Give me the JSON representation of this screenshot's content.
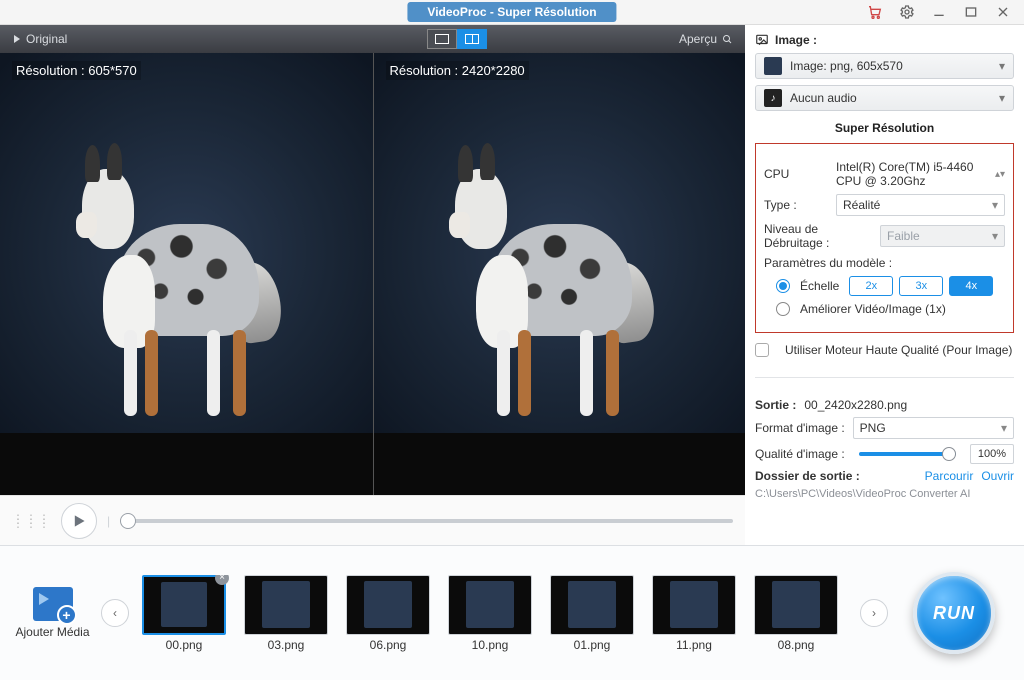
{
  "titlebar": {
    "title": "VideoProc  -  Super Résolution"
  },
  "preview": {
    "original_label": "Original",
    "apercu_label": "Aperçu",
    "left_res": "Résolution : 605*570",
    "right_res": "Résolution : 2420*2280"
  },
  "side": {
    "image_section": "Image :",
    "image_row": "Image: png, 605x570",
    "audio_row": "Aucun audio",
    "sr_title": "Super Résolution",
    "cpu_label": "CPU",
    "cpu_value": "Intel(R) Core(TM) i5-4460 CPU @ 3.20Ghz",
    "type_label": "Type :",
    "type_value": "Réalité",
    "denoise_label": "Niveau de Débruitage :",
    "denoise_value": "Faible",
    "model_label": "Paramètres du modèle :",
    "scale_label": "Échelle",
    "scale_2x": "2x",
    "scale_3x": "3x",
    "scale_4x": "4x",
    "enhance_label": "Améliorer Vidéo/Image (1x)",
    "hq_engine": "Utiliser Moteur Haute Qualité (Pour Image)",
    "output": {
      "sortie_label": "Sortie :",
      "sortie_value": "00_2420x2280.png",
      "format_label": "Format d'image :",
      "format_value": "PNG",
      "quality_label": "Qualité d'image :",
      "quality_value": "100%",
      "folder_label": "Dossier de sortie :",
      "browse": "Parcourir",
      "open": "Ouvrir",
      "path": "C:\\Users\\PC\\Videos\\VideoProc Converter AI"
    }
  },
  "bottom": {
    "add_media": "Ajouter Média",
    "files": [
      "00.png",
      "03.png",
      "06.png",
      "10.png",
      "01.png",
      "11.png",
      "08.png"
    ],
    "run": "RUN"
  }
}
